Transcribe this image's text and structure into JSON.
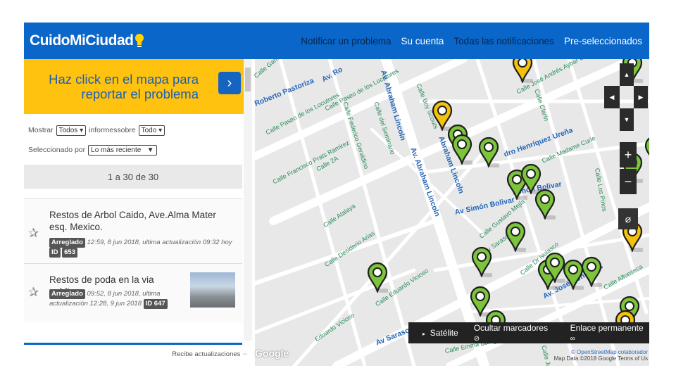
{
  "header": {
    "logo_text": "CuidoMiCiudad",
    "nav": [
      {
        "label": "Notificar un problema",
        "style": "dim"
      },
      {
        "label": "Su cuenta",
        "style": "lit"
      },
      {
        "label": "Todas las notificaciones",
        "style": "dim"
      },
      {
        "label": "Pre-seleccionados",
        "style": "lit"
      }
    ]
  },
  "cta": {
    "line1": "Haz click en el mapa para",
    "line2": "reportar el problema",
    "arrow": "›"
  },
  "filters": {
    "show_label": "Mostrar",
    "show_value": "Todos",
    "about_label": "informessobre",
    "about_value": "Todo",
    "sort_label": "Seleccionado por",
    "sort_value": "Lo más reciente"
  },
  "pager": "1 a 30 de 30",
  "reports": [
    {
      "title": "Restos de Arbol Caido, Ave.Alma Mater esq. Mexico.",
      "status": "Arreglado",
      "meta": "12:59, 8 jun 2018, ultima actualización 09:32 hoy",
      "id_label": "ID",
      "id": "653"
    },
    {
      "title": "Restos de poda en la via publica",
      "status": "Arreglado",
      "meta_1": "09:52, 8 jun 2018, ultima",
      "meta_2": "actualización 12:28, 9 jun 2018",
      "id_badge": "ID 647"
    }
  ],
  "subscribe": "Recibe actualizaciones",
  "map": {
    "labels": [
      {
        "text": "Roberto Pastoriza",
        "big": true
      },
      {
        "text": "Av. Ro",
        "big": true
      },
      {
        "text": "Av. Abraham Lincoln",
        "big": true
      },
      {
        "text": "Av. Abraham Lincoln",
        "big": true
      },
      {
        "text": "Abraham Lincoln",
        "big": true
      },
      {
        "text": "Av Simón Bolivar",
        "big": true
      },
      {
        "text": "Simón Bolivar",
        "big": true
      },
      {
        "text": "dro Henríquez Ureña",
        "big": true
      },
      {
        "text": "Av. José Contreras",
        "big": true
      },
      {
        "text": "Av Sarasota",
        "big": true
      },
      {
        "text": "Calle Paseo de los Locutores",
        "big": false
      },
      {
        "text": "Calle Paseo de los Locutores",
        "big": false
      },
      {
        "text": "Calle Francisco Prats Ramirez",
        "big": false
      },
      {
        "text": "Calle Federico Geraldino",
        "big": false
      },
      {
        "text": "Calle del Seminario",
        "big": false
      },
      {
        "text": "Calle 2A",
        "big": false
      },
      {
        "text": "Calle Atalaya",
        "big": false
      },
      {
        "text": "Calle Desiderio Arias",
        "big": false
      },
      {
        "text": "Calle Eduardo Vicioso",
        "big": false
      },
      {
        "text": "Eduardo Vicioso",
        "big": false
      },
      {
        "text": "Calle Madame Curie",
        "big": false
      },
      {
        "text": "Calle José Andrés Aybar Castellanos",
        "big": false
      },
      {
        "text": "Calle Clarín",
        "big": false
      },
      {
        "text": "Calle Boy Scouts",
        "big": false
      },
      {
        "text": "Calle Los Pinos",
        "big": false
      },
      {
        "text": "Calle Emma Balaguer",
        "big": false
      },
      {
        "text": "Calle Dr Nolasco",
        "big": false
      },
      {
        "text": "Calle Juan",
        "big": false
      },
      {
        "text": "Calle Garrido",
        "big": false
      },
      {
        "text": "Av Sarasota",
        "big": false
      },
      {
        "text": "Calle Gustavo Mejía",
        "big": false
      },
      {
        "text": "Calle Alfonseca",
        "big": false
      }
    ],
    "google": "Google",
    "toolbar": {
      "satellite": "Satélite",
      "hide_markers": "Ocultar marcadores",
      "permalink": "Enlace permanente"
    },
    "attribution_1": "© OpenStreetMap colaborador",
    "attribution_2": "Map Data ©2018 Google   Terms of Us"
  },
  "colors": {
    "brand_blue": "#0a66c8",
    "cta_yellow": "#ffc20e",
    "pin_green": "#7cc43a",
    "pin_yellow": "#f4c20d"
  }
}
